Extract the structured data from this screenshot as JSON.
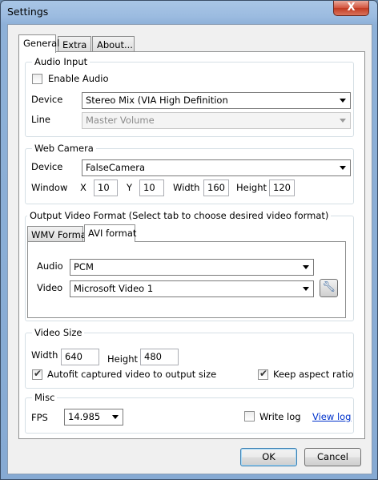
{
  "window": {
    "title": "Settings",
    "close_glyph": "X"
  },
  "tabs": [
    {
      "label": "General"
    },
    {
      "label": "Extra"
    },
    {
      "label": "About..."
    }
  ],
  "audio_input": {
    "title": "Audio Input",
    "enable_audio": {
      "label": "Enable Audio",
      "checked": false
    },
    "device": {
      "label": "Device",
      "value": "Stereo Mix (VIA High Definition"
    },
    "line": {
      "label": "Line",
      "value": "Master Volume",
      "disabled": true
    }
  },
  "web_camera": {
    "title": "Web Camera",
    "device": {
      "label": "Device",
      "value": "FalseCamera"
    },
    "window_label": "Window",
    "x": {
      "label": "X",
      "value": "10"
    },
    "y": {
      "label": "Y",
      "value": "10"
    },
    "width": {
      "label": "Width",
      "value": "160"
    },
    "height": {
      "label": "Height",
      "value": "120"
    }
  },
  "output_format": {
    "title": "Output Video Format (Select tab to choose desired video format)",
    "tabs": [
      {
        "label": "WMV Format"
      },
      {
        "label": "AVI format"
      }
    ],
    "audio": {
      "label": "Audio",
      "value": "PCM"
    },
    "video": {
      "label": "Video",
      "value": "Microsoft Video 1"
    },
    "configure_icon": "wrench-icon"
  },
  "video_size": {
    "title": "Video Size",
    "width": {
      "label": "Width",
      "value": "640"
    },
    "height": {
      "label": "Height",
      "value": "480"
    },
    "autofit": {
      "label": "Autofit captured video to output size",
      "checked": true
    },
    "keep_aspect": {
      "label": "Keep aspect ratio",
      "checked": true
    }
  },
  "misc": {
    "title": "Misc",
    "fps": {
      "label": "FPS",
      "value": "14.985"
    },
    "write_log": {
      "label": "Write log",
      "checked": false
    },
    "view_log": "View log"
  },
  "buttons": {
    "ok": "OK",
    "cancel": "Cancel"
  },
  "colors": {
    "titlebar": "#9bbbe0",
    "close_button": "#c23a22",
    "link": "#0033cc",
    "default_button_border": "#3c7fb1"
  }
}
